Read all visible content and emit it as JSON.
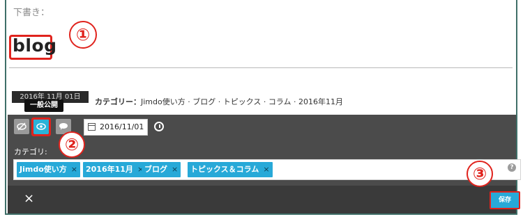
{
  "editor": {
    "draft_label": "下書き：",
    "title_value": "blog",
    "date_label": "2016年 11月 01日",
    "meta": {
      "category_prefix": "カテゴリー：",
      "category_text": "Jimdo使い方 · ブログ · トピックス · コラム · 2016年11月"
    }
  },
  "annotations": {
    "step1": "①",
    "step2": "②",
    "step3": "③"
  },
  "toolbar": {
    "tooltip": "一般公開",
    "date_value": "2016/11/01",
    "icons": {
      "hidden": "eye-slash-icon",
      "public": "eye-icon",
      "comment": "comment-icon",
      "calendar": "calendar-icon",
      "clock": "clock-icon"
    }
  },
  "category": {
    "label": "カテゴリ:",
    "tags": [
      {
        "label": "Jimdo使い方",
        "remove": "×"
      },
      {
        "label": "2016年11月",
        "remove": "×"
      },
      {
        "label": "ブログ",
        "remove": "×"
      },
      {
        "label": "トピックス＆コラム",
        "remove": "×"
      }
    ],
    "help": "?"
  },
  "footer": {
    "close": "×",
    "save_label": "保存"
  },
  "colors": {
    "accent": "#27a9d8",
    "annotation": "#e0231d",
    "toolbar_bg": "#4b4b4b"
  }
}
